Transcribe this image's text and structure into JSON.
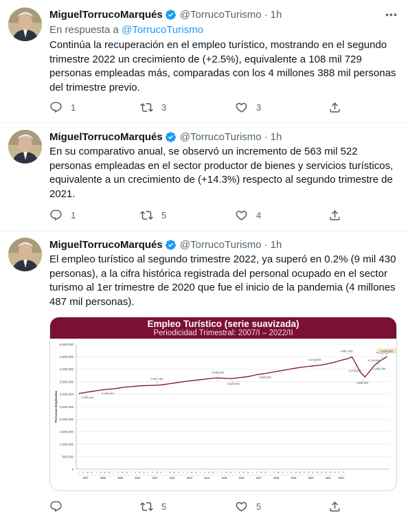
{
  "colors": {
    "accent": "#1d9bf0",
    "chart_line": "#7b1034",
    "chart_banner": "#7b1034"
  },
  "tweets": [
    {
      "name": "MiguelTorrucoMarqués",
      "handle": "@TorrucoTurismo",
      "dot": "·",
      "time": "1h",
      "reply_prefix": "En respuesta a",
      "reply_handle": "@TorrucoTurismo",
      "text": "Continúa la recuperación en el empleo turístico, mostrando en el segundo trimestre 2022 un crecimiento de (+2.5%), equivalente a 108 mil 729 personas empleadas más, comparadas con los 4 millones 388 mil personas del trimestre previo.",
      "replies": "1",
      "retweets": "3",
      "likes": "3"
    },
    {
      "name": "MiguelTorrucoMarqués",
      "handle": "@TorrucoTurismo",
      "dot": "·",
      "time": "1h",
      "text": "En su comparativo anual, se observó un incremento de 563 mil 522 personas empleadas en el sector productor de bienes y servicios turísticos, equivalente a un crecimiento de (+14.3%) respecto al segundo trimestre de 2021.",
      "replies": "1",
      "retweets": "5",
      "likes": "4"
    },
    {
      "name": "MiguelTorrucoMarqués",
      "handle": "@TorrucoTurismo",
      "dot": "·",
      "time": "1h",
      "text": "El empleo turístico al segundo trimestre 2022, ya superó en 0.2% (9 mil  430  personas), a la cifra histórica registrada del personal ocupado en el sector turismo al 1er trimestre de 2020 que fue el inicio de la pandemia (4 millones 487 mil personas).",
      "replies": "",
      "retweets": "5",
      "likes": "5"
    }
  ],
  "chart_data": {
    "type": "line",
    "title": "Empleo Turístico (serie suavizada)",
    "subtitle": "Periodicidad Trimestral: 2007/I – 2022/II",
    "ylabel": "Personas Empleadas",
    "xlabel": "",
    "ylim": [
      0,
      5000000
    ],
    "yticks": [
      "0",
      "500,000",
      "1,000,000",
      "1,500,000",
      "2,000,000",
      "2,500,000",
      "3,000,000",
      "3,500,000",
      "4,000,000",
      "4,500,000",
      "5,000,000"
    ],
    "years": [
      "2007",
      "2008",
      "2009",
      "2010",
      "2011",
      "2012",
      "2013",
      "2014",
      "2015",
      "2016",
      "2017",
      "2018",
      "2019",
      "2020",
      "2021",
      "2022"
    ],
    "quarter_labels": [
      "I",
      "II",
      "III",
      "IV"
    ],
    "quarter_labels_late": [
      "1ª",
      "2ª",
      "3ª",
      "4ª"
    ],
    "grid": true,
    "legend": "none",
    "values": [
      3030000,
      3055441,
      3085000,
      3110000,
      3135000,
      3160000,
      3186444,
      3200000,
      3215000,
      3240000,
      3265000,
      3290000,
      3300000,
      3315000,
      3330000,
      3340000,
      3345000,
      3350000,
      3357780,
      3370000,
      3395000,
      3420000,
      3445000,
      3470000,
      3495000,
      3520000,
      3540000,
      3560000,
      3580000,
      3600000,
      3620000,
      3640000,
      3646596,
      3640000,
      3630000,
      3622603,
      3640000,
      3660000,
      3680000,
      3700000,
      3740000,
      3780000,
      3803642,
      3830000,
      3860000,
      3890000,
      3920000,
      3950000,
      3980000,
      4010000,
      4040000,
      4070000,
      4090000,
      4110000,
      4130000,
      4144803,
      4170000,
      4200000,
      4240000,
      4280000,
      4330000,
      4380000,
      4420000,
      4487429,
      4176019,
      3860000,
      3688595,
      3900000,
      4120000,
      4264200,
      4388120,
      4496859
    ],
    "annotations": [
      {
        "label": "3,055,441",
        "index": 1
      },
      {
        "label": "3,186,444",
        "index": 6
      },
      {
        "label": "3,357,780",
        "index": 18
      },
      {
        "label": "3,646,596",
        "index": 32
      },
      {
        "label": "3,622,603",
        "index": 35
      },
      {
        "label": "3,803,642",
        "index": 42
      },
      {
        "label": "4,144,803",
        "index": 55
      },
      {
        "label": "4,487,429",
        "index": 63
      },
      {
        "label": "4,176,019",
        "index": 64
      },
      {
        "label": "3,688,595",
        "index": 66
      },
      {
        "label": "4,124,549",
        "index": 68
      },
      {
        "label": "4,264,200",
        "index": 69
      },
      {
        "label": "4,388,120",
        "index": 70
      },
      {
        "label": "4,496,859",
        "index": 71
      }
    ]
  }
}
